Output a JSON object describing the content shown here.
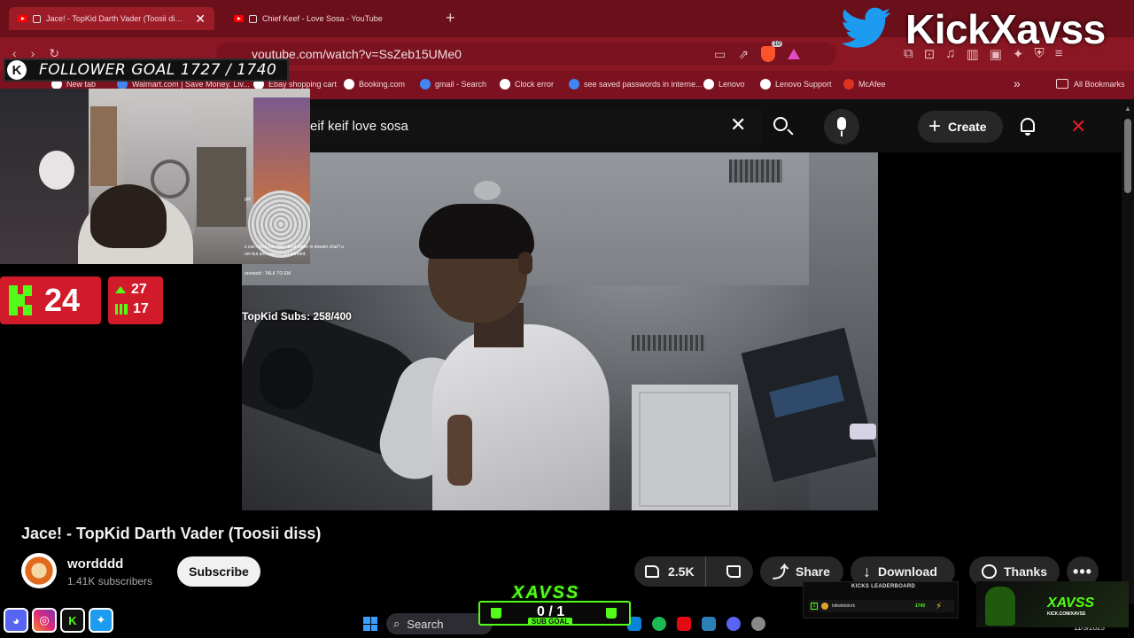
{
  "browser": {
    "tabs": [
      {
        "title": "Jace! - TopKid Darth Vader (Toosii diss) - You",
        "active": true
      },
      {
        "title": "Chief Keef - Love Sosa - YouTube",
        "active": false
      }
    ],
    "url": "youtube.com/watch?v=SsZeb15UMe0",
    "brave_badge": "10",
    "bookmarks": [
      "New tab",
      "Walmart.com | Save Money. Liv...",
      "Ebay shopping cart",
      "Booking.com",
      "gmail - Search",
      "Clock error",
      "see saved passwords in interne...",
      "Lenovo",
      "Lenovo Support",
      "McAfee"
    ],
    "all_bookmarks": "All Bookmarks"
  },
  "youtube": {
    "search_query": "eif keif love sosa",
    "create_label": "Create",
    "video_title": "Jace! - TopKid Darth Vader (Toosii diss)",
    "channel_name": "wordddd",
    "channel_subs": "1.41K subscribers",
    "subscribe_label": "Subscribe",
    "likes": "2.5K",
    "share_label": "Share",
    "download_label": "Download",
    "thanks_label": "Thanks"
  },
  "overlay": {
    "follower_goal": "FOLLOWER GOAL 1727 / 1740",
    "brand": "KickXavss",
    "viewers": "24",
    "stat_up": "27",
    "stat_bars": "17",
    "chat": [
      {
        "text": "got"
      },
      {
        "text": "s can i post this 200+ beat folder in stream chat? u"
      },
      {
        "text": "um but ain't wanna get banned."
      },
      {
        "text": "rarewzid : TALK TO EM"
      }
    ],
    "subs_goal_text": "TopKid Subs: 258/400",
    "sub_goal": {
      "brand": "XAVSS",
      "count": "0 / 1",
      "label": "SUB GOAL"
    },
    "leaderboard": {
      "title": "KICKS LEADERBOARD",
      "rank": "1",
      "name": "biitwiteblork",
      "value": "1740"
    },
    "logo": {
      "brand": "XAVSS",
      "url": "KICK.COM/XAVSS"
    }
  },
  "taskbar": {
    "search_label": "Search",
    "date": "11/5/2025"
  },
  "colors": {
    "browser_chrome": "#8a1723",
    "kick_green": "#53fc18",
    "stats_red": "#d11a2a",
    "youtube_bg": "#0f0f0f"
  }
}
